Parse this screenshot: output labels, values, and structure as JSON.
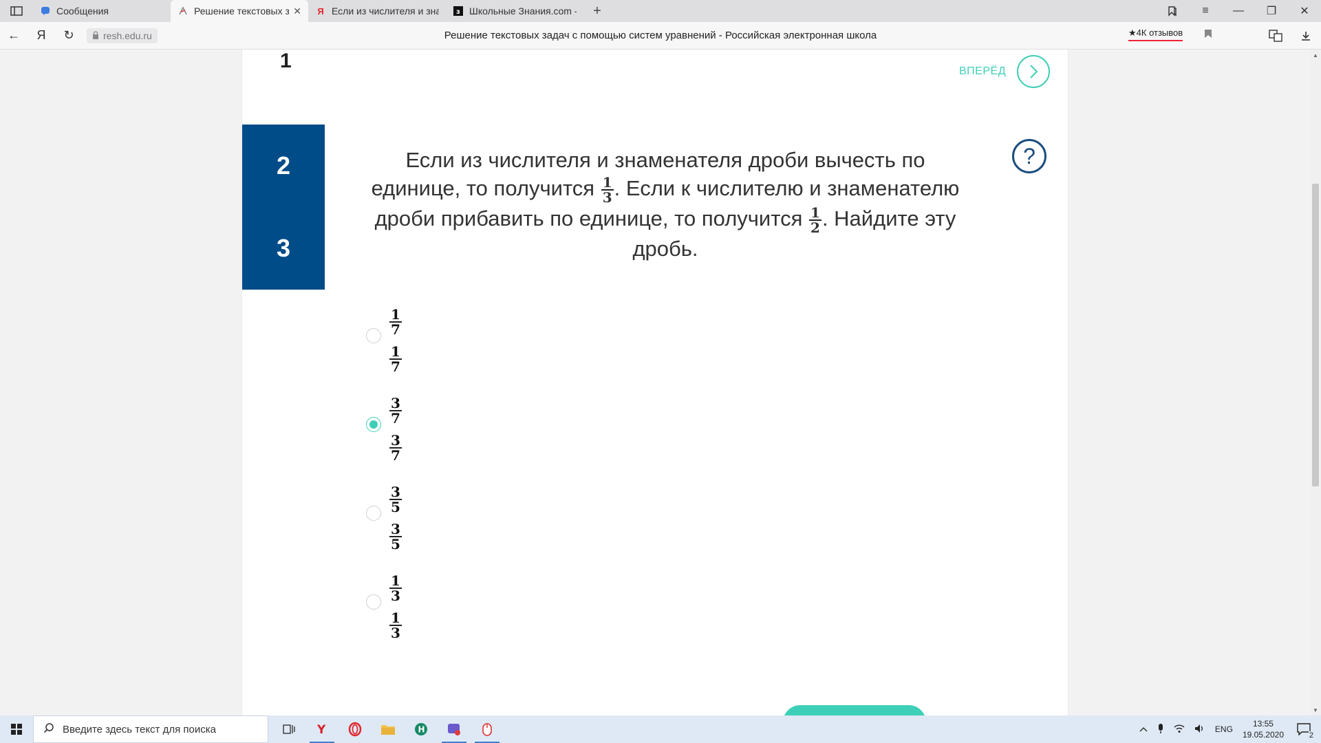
{
  "browser": {
    "tabs": [
      {
        "title": "Сообщения",
        "icon": "chat-icon",
        "active": false
      },
      {
        "title": "Решение текстовых зад",
        "icon": "resh-logo-icon",
        "active": true
      },
      {
        "title": "Если из числителя и знаме",
        "icon": "yandex-icon",
        "active": false
      },
      {
        "title": "Школьные Знания.com - Р",
        "icon": "znanija-icon",
        "active": false
      }
    ],
    "domain": "resh.edu.ru",
    "page_title": "Решение текстовых задач с помощью систем уравнений - Российская электронная школа",
    "reviews": "★4К отзывов",
    "yandex_letter": "Я"
  },
  "page": {
    "prev_number": "1",
    "forward_label": "ВПЕРЁД",
    "question_nav": [
      "2",
      "3"
    ],
    "question": {
      "part1": "Если из числителя и знаменателя дроби вычесть по единице, то получится",
      "frac1": {
        "num": "1",
        "den": "3"
      },
      "part2": ". Если к числителю и знаменателю дроби прибавить по единице, то получится",
      "frac2": {
        "num": "1",
        "den": "2"
      },
      "part3": ". Найдите эту дробь."
    },
    "answers": [
      {
        "num": "1",
        "den": "7",
        "selected": false
      },
      {
        "num": "3",
        "den": "7",
        "selected": true
      },
      {
        "num": "3",
        "den": "5",
        "selected": false
      },
      {
        "num": "1",
        "den": "3",
        "selected": false
      }
    ],
    "help_symbol": "?"
  },
  "taskbar": {
    "search_placeholder": "Введите здесь текст для поиска",
    "language": "ENG",
    "time": "13:55",
    "date": "19.05.2020",
    "notification_count": "2"
  },
  "colors": {
    "accent": "#3ecfb8",
    "nav_blue": "#004c89"
  }
}
